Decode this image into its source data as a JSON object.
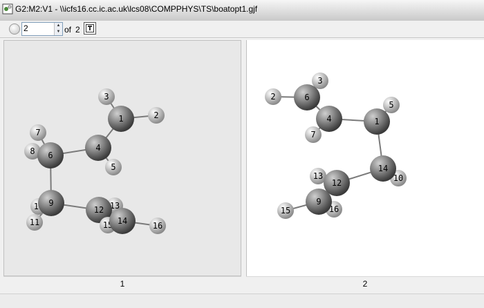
{
  "window": {
    "title": "G2:M2:V1 - \\\\icfs16.cc.ic.ac.uk\\lcs08\\COMPPHYS\\TS\\boatopt1.gjf"
  },
  "toolbar": {
    "frame_value": "2",
    "of_label": "of",
    "frame_total": "2"
  },
  "viewers": [
    {
      "caption": "1",
      "bonds": [
        [
          1,
          3
        ],
        [
          1,
          2
        ],
        [
          1,
          4
        ],
        [
          4,
          5
        ],
        [
          4,
          6
        ],
        [
          6,
          7
        ],
        [
          6,
          8
        ],
        [
          6,
          9
        ],
        [
          9,
          10
        ],
        [
          9,
          11
        ],
        [
          9,
          12
        ],
        [
          12,
          13
        ],
        [
          12,
          14
        ],
        [
          14,
          15
        ],
        [
          14,
          16
        ]
      ],
      "atoms": [
        {
          "label": "3",
          "el": "H"
        },
        {
          "label": "2",
          "el": "H"
        },
        {
          "label": "7",
          "el": "H"
        },
        {
          "label": "8",
          "el": "H"
        },
        {
          "label": "5",
          "el": "H"
        },
        {
          "label": "10",
          "el": "H"
        },
        {
          "label": "11",
          "el": "H"
        },
        {
          "label": "16",
          "el": "H"
        },
        {
          "label": "1",
          "el": "C"
        },
        {
          "label": "4",
          "el": "C"
        },
        {
          "label": "6",
          "el": "C"
        },
        {
          "label": "9",
          "el": "C"
        },
        {
          "label": "13",
          "el": "H"
        },
        {
          "label": "12",
          "el": "C"
        },
        {
          "label": "15",
          "el": "H"
        },
        {
          "label": "14",
          "el": "C"
        }
      ]
    },
    {
      "caption": "2",
      "bonds": [
        [
          6,
          3
        ],
        [
          6,
          2
        ],
        [
          6,
          4
        ],
        [
          4,
          7
        ],
        [
          4,
          1
        ],
        [
          1,
          5
        ],
        [
          1,
          14
        ],
        [
          14,
          10
        ],
        [
          14,
          12
        ],
        [
          12,
          13
        ],
        [
          12,
          9
        ],
        [
          9,
          15
        ],
        [
          9,
          16
        ]
      ],
      "atoms": [
        {
          "label": "3",
          "el": "H"
        },
        {
          "label": "2",
          "el": "H"
        },
        {
          "label": "7",
          "el": "H"
        },
        {
          "label": "5",
          "el": "H"
        },
        {
          "label": "10",
          "el": "H"
        },
        {
          "label": "13",
          "el": "H"
        },
        {
          "label": "15",
          "el": "H"
        },
        {
          "label": "16",
          "el": "H"
        },
        {
          "label": "6",
          "el": "C"
        },
        {
          "label": "4",
          "el": "C"
        },
        {
          "label": "1",
          "el": "C"
        },
        {
          "label": "14",
          "el": "C"
        },
        {
          "label": "12",
          "el": "C"
        },
        {
          "label": "9",
          "el": "C"
        }
      ]
    }
  ]
}
